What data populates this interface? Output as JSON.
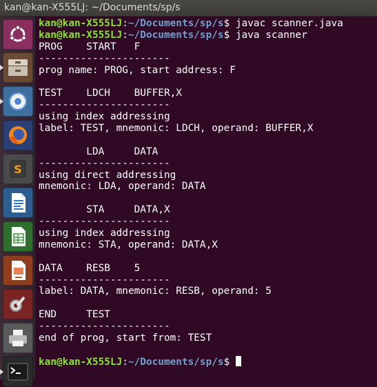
{
  "window": {
    "title": "kan@kan-X555LJ: ~/Documents/sp/s"
  },
  "launcher": [
    {
      "name": "ubuntu-logo-icon",
      "color": "#7d2a57"
    },
    {
      "name": "files-icon",
      "color": "#8a5a3a"
    },
    {
      "name": "chromium-icon",
      "color": "#2a6fb0"
    },
    {
      "name": "firefox-icon",
      "color": "#e66000"
    },
    {
      "name": "sublime-text-icon",
      "color": "#3b3b3b"
    },
    {
      "name": "libreoffice-writer-icon",
      "color": "#2a78c9"
    },
    {
      "name": "libreoffice-calc-icon",
      "color": "#3a9a3a"
    },
    {
      "name": "libreoffice-impress-icon",
      "color": "#c8502a"
    },
    {
      "name": "system-settings-icon",
      "color": "#b93030"
    },
    {
      "name": "printer-icon",
      "color": "#7a7a7a"
    },
    {
      "name": "terminal-icon",
      "color": "#2b2b2b"
    }
  ],
  "terminal": {
    "prompt_user": "kan@kan-X555LJ",
    "prompt_sep": ":",
    "prompt_path": "~/Documents/sp/s",
    "prompt_symbol": "$ ",
    "commands": [
      "javac scanner.java",
      "java scanner",
      ""
    ],
    "output": [
      "PROG    START   F",
      "----------------------",
      "prog name: PROG, start address: F",
      "",
      "TEST    LDCH    BUFFER,X",
      "----------------------",
      "using index addressing",
      "label: TEST, mnemonic: LDCH, operand: BUFFER,X",
      "",
      "        LDA     DATA",
      "----------------------",
      "using direct addressing",
      "mnemonic: LDA, operand: DATA",
      "",
      "        STA     DATA,X",
      "----------------------",
      "using index addressing",
      "mnemonic: STA, operand: DATA,X",
      "",
      "DATA    RESB    5",
      "----------------------",
      "label: DATA, mnemonic: RESB, operand: 5",
      "",
      "END     TEST",
      "----------------------",
      "end of prog, start from: TEST",
      ""
    ]
  }
}
